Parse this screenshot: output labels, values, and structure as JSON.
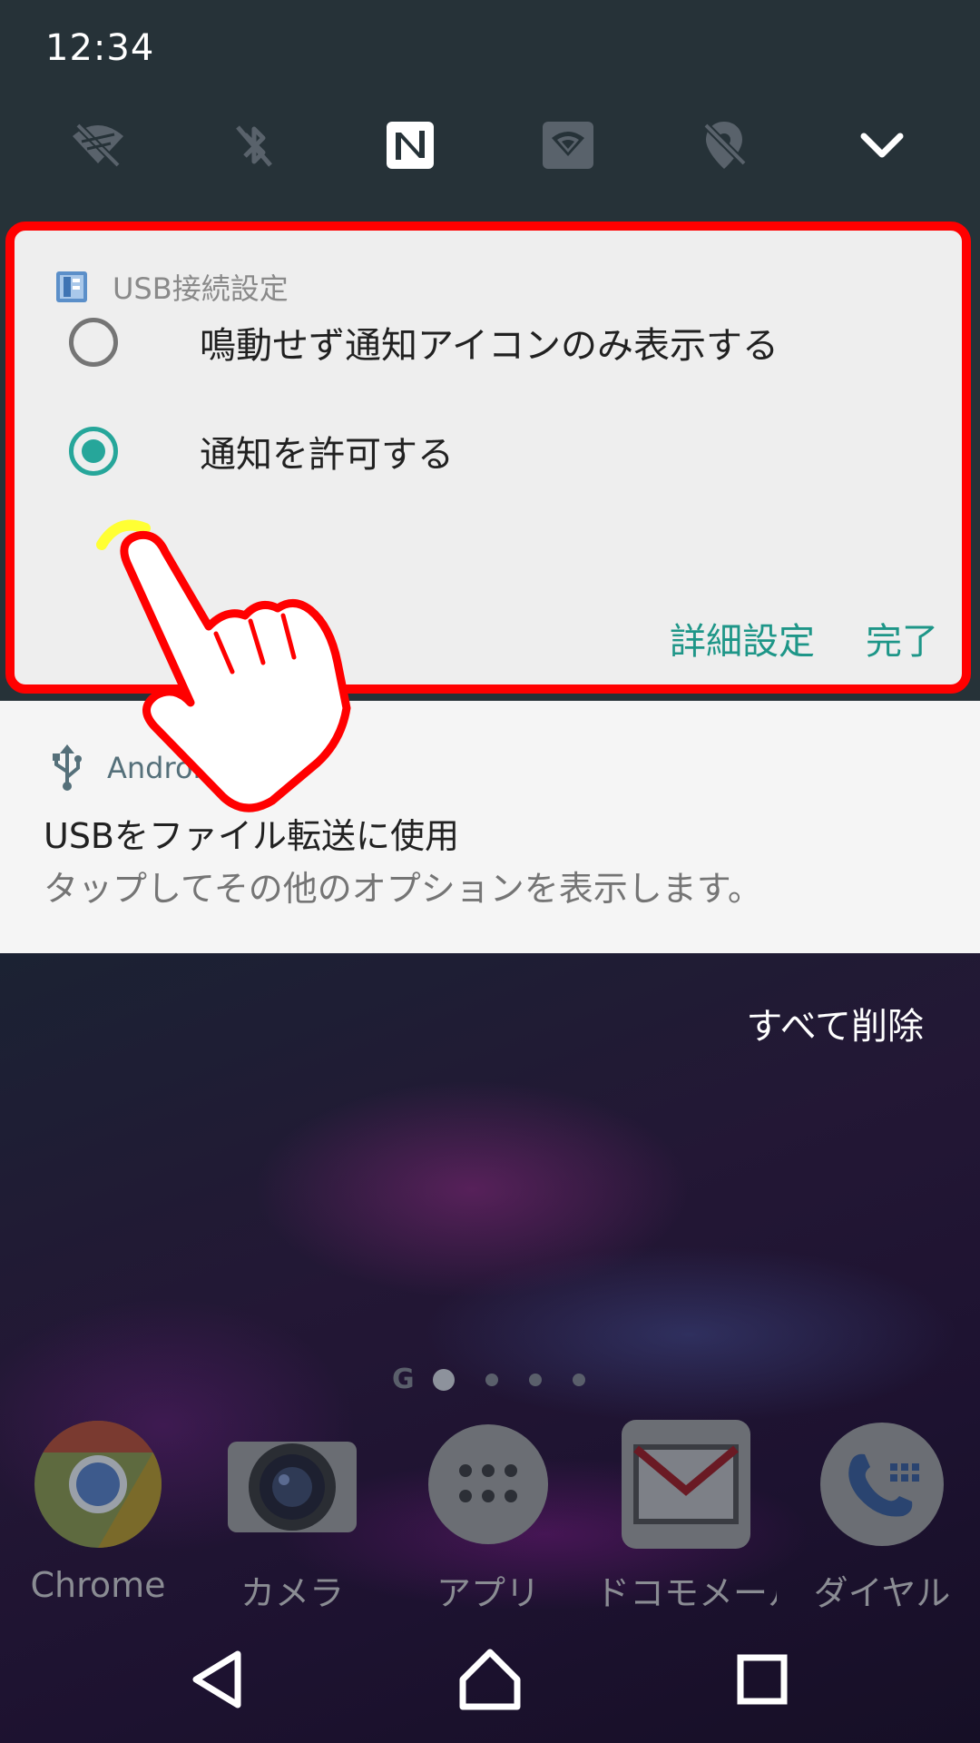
{
  "status_bar": {
    "time": "12:34"
  },
  "quick_settings": {
    "icons": [
      "wifi-off-icon",
      "bluetooth-off-icon",
      "nfc-icon",
      "hotspot-icon",
      "location-off-icon",
      "chevron-down-icon"
    ]
  },
  "usb_card": {
    "app_name": "USB接続設定",
    "options": [
      {
        "label": "鳴動せず通知アイコンのみ表示する",
        "selected": false
      },
      {
        "label": "通知を許可する",
        "selected": true
      }
    ],
    "actions": {
      "details": "詳細設定",
      "done": "完了"
    },
    "accent_color": "#26a69a",
    "highlight_color": "#ff0000"
  },
  "system_notification": {
    "app_name": "Android",
    "title": "USBをファイル転送に使用",
    "text": "タップしてその他のオプションを表示します。"
  },
  "home": {
    "clear_all": "すべて削除",
    "page_indicator_letter": "G",
    "page_count": 4,
    "active_page": 0,
    "dock": [
      {
        "label": "Chrome",
        "icon": "chrome-icon"
      },
      {
        "label": "カメラ",
        "icon": "camera-icon"
      },
      {
        "label": "アプリ",
        "icon": "apps-icon"
      },
      {
        "label": "ドコモメール",
        "icon": "mail-icon"
      },
      {
        "label": "ダイヤル",
        "icon": "phone-icon"
      }
    ]
  },
  "nav_bar": {
    "buttons": [
      "back-icon",
      "home-icon",
      "recents-icon"
    ]
  }
}
